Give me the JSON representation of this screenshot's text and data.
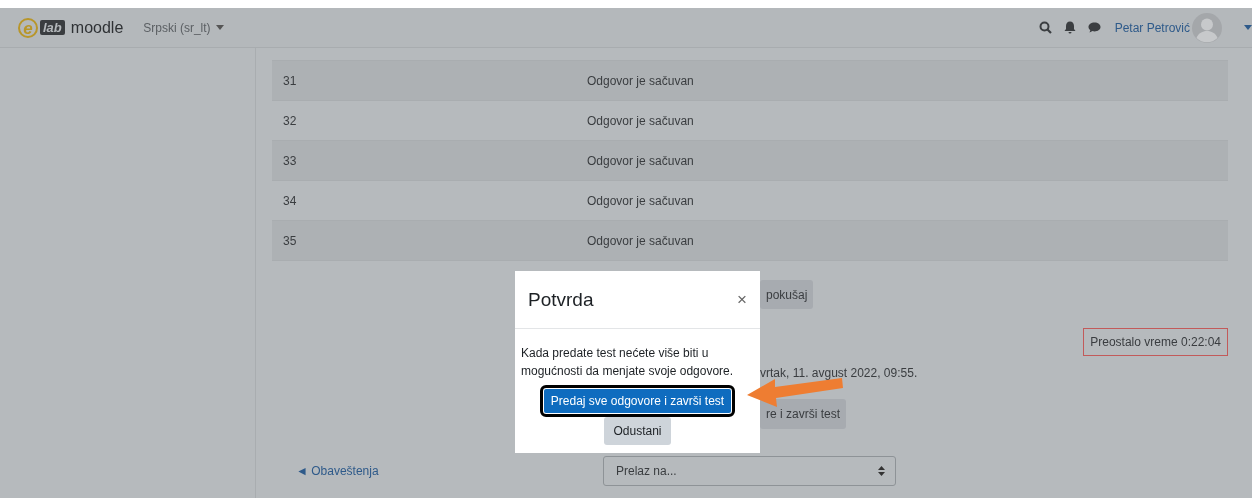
{
  "navbar": {
    "logo": {
      "letter": "e",
      "mark": "lab",
      "name": "moodle"
    },
    "language": "Srpski (sr_lt)",
    "user_name": "Petar Petrović"
  },
  "summary_rows": [
    {
      "number": "31",
      "status": "Odgovor je sačuvan"
    },
    {
      "number": "32",
      "status": "Odgovor je sačuvan"
    },
    {
      "number": "33",
      "status": "Odgovor je sačuvan"
    },
    {
      "number": "34",
      "status": "Odgovor je sačuvan"
    },
    {
      "number": "35",
      "status": "Odgovor je sačuvan"
    }
  ],
  "return_button": "pokušaj",
  "timer": "Preostalo vreme 0:22:04",
  "deadline_text": "vrtak, 11. avgust 2022, 09:55.",
  "submit_button": "re i završi test",
  "nav": {
    "prev_link": "◄ Obaveštenja",
    "jump_select": "Prelaz na..."
  },
  "modal": {
    "title": "Potvrda",
    "close": "×",
    "message": "Kada predate test nećete više biti u mogućnosti da menjate svoje odgovore.",
    "confirm_button": "Predaj sve odgovore i završi test",
    "cancel_button": "Odustani"
  }
}
